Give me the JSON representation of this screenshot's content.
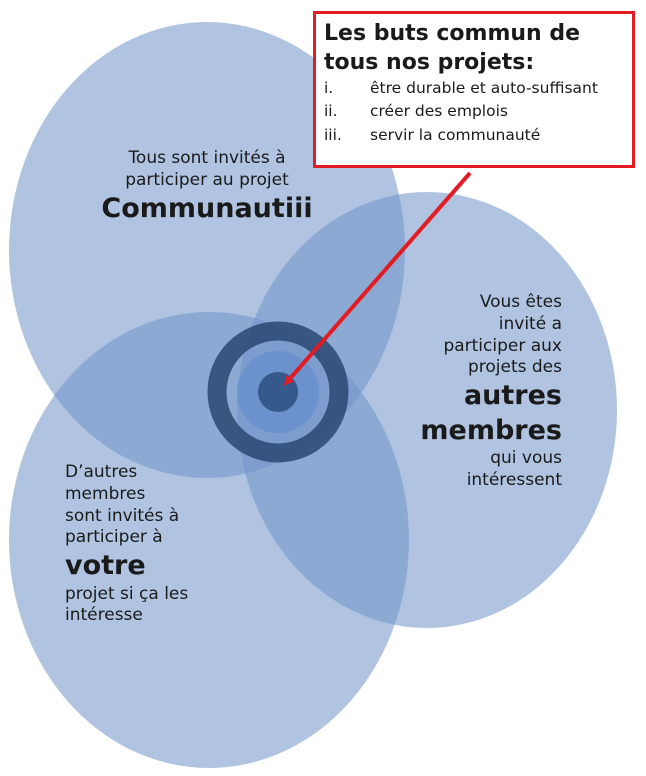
{
  "circle_top": {
    "lines": [
      "Tous sont invités à",
      "participer au projet"
    ],
    "emphasis": "Communautiii"
  },
  "circle_right": {
    "lines": [
      "Vous êtes",
      "invité a",
      "participer aux",
      "projets des"
    ],
    "emphasis": [
      "autres",
      "membres"
    ],
    "tail": [
      "qui vous",
      "intéressent"
    ]
  },
  "circle_left": {
    "lines": [
      "D’autres",
      "membres",
      "sont invités à",
      "participer à"
    ],
    "emphasis": "votre",
    "tail": [
      "projet si ça les",
      "intéresse"
    ]
  },
  "goals": {
    "title_line1": "Les buts commun de",
    "title_line2": "tous nos projets:",
    "items": [
      {
        "num": "i.",
        "text": "être durable et auto-suffisant"
      },
      {
        "num": "ii.",
        "text": "créer des emplois"
      },
      {
        "num": "iii.",
        "text": "servir  la communauté"
      }
    ]
  },
  "colors": {
    "circle_fill": "#7094c9",
    "target_ring": "#2e4e78",
    "arrow": "#e31b23"
  }
}
